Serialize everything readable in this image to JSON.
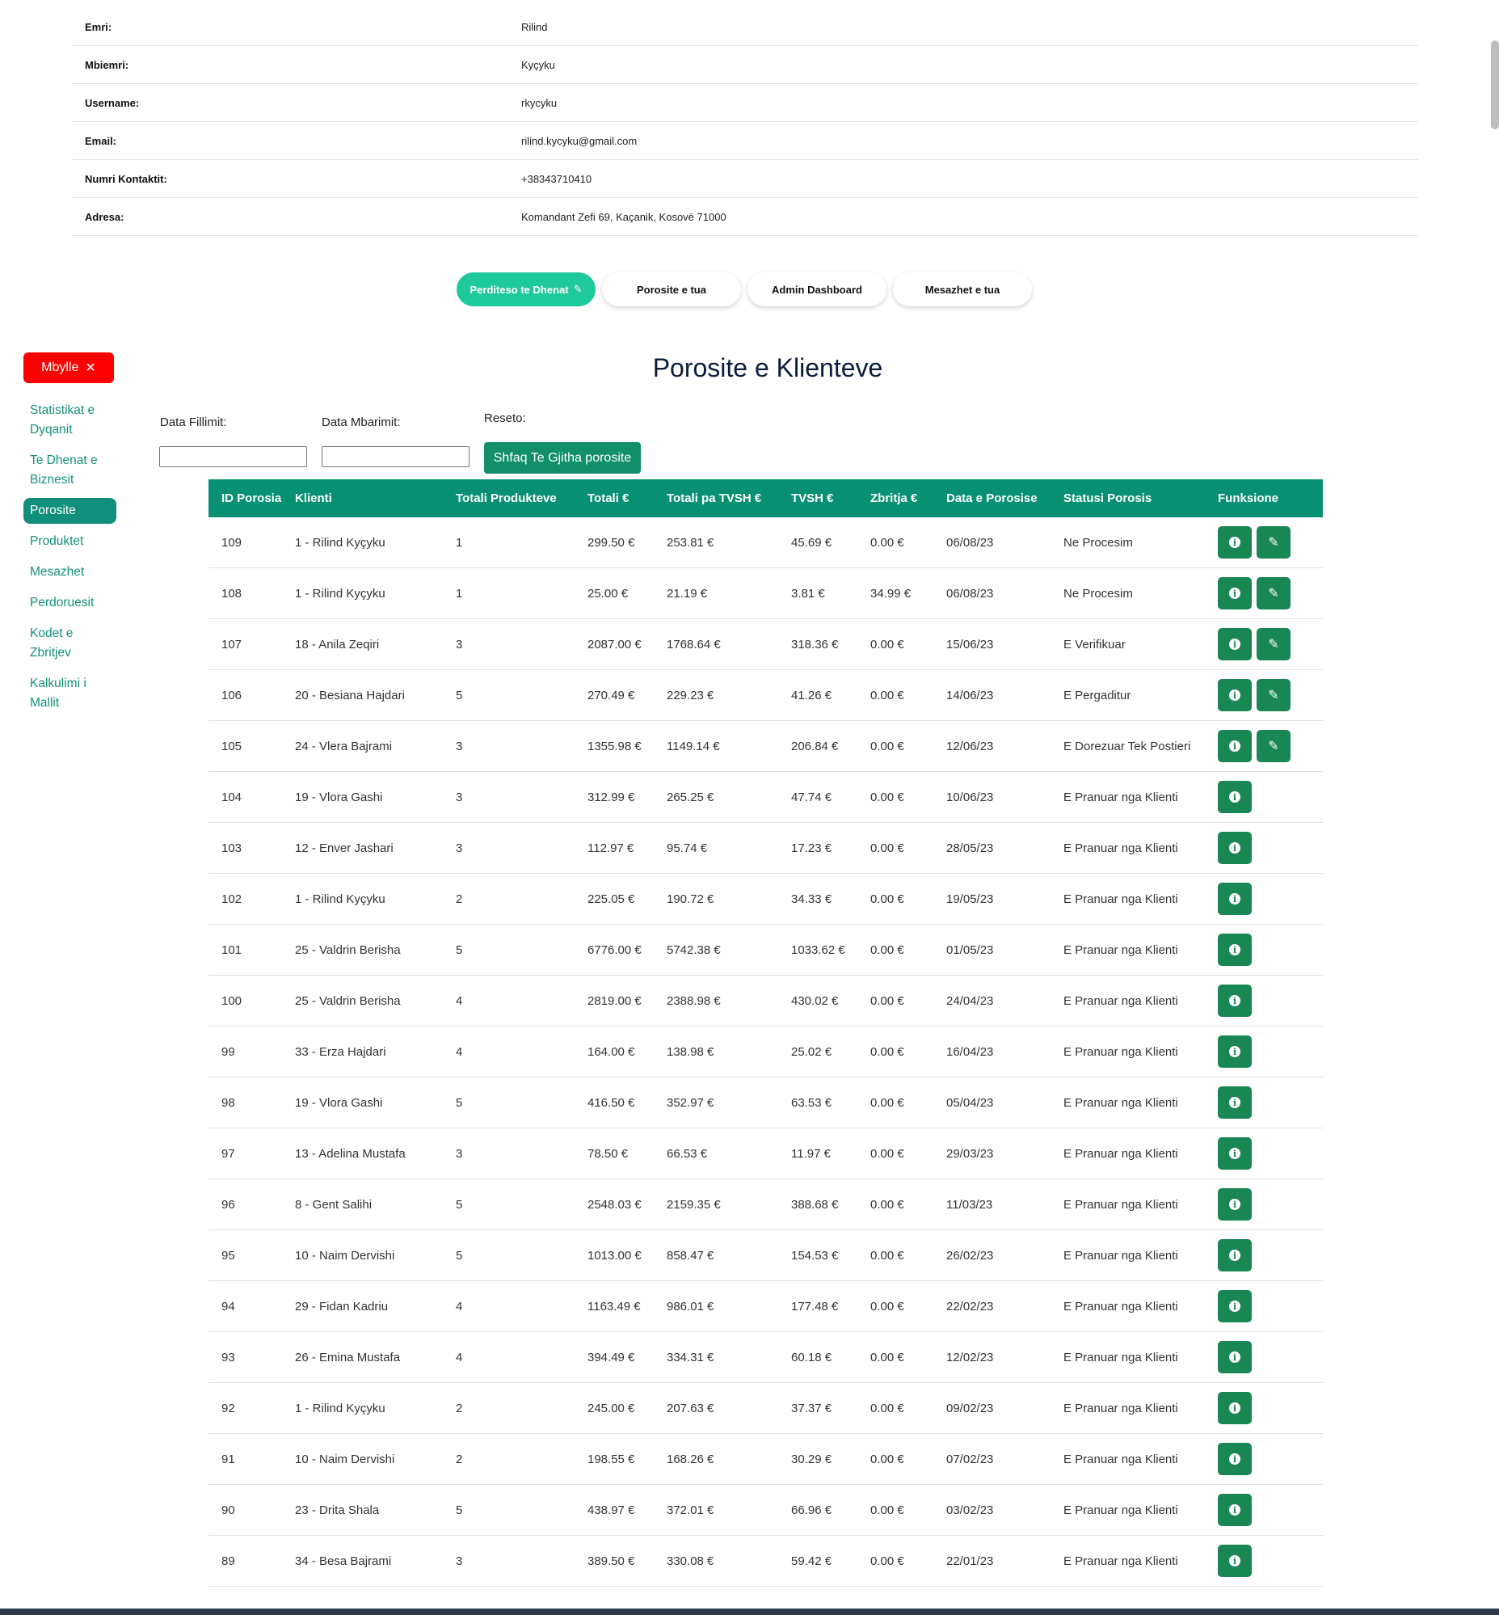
{
  "profile": [
    {
      "label": "Emri:",
      "value": "Rilind"
    },
    {
      "label": "Mbiemri:",
      "value": "Kyçyku"
    },
    {
      "label": "Username:",
      "value": "rkycyku"
    },
    {
      "label": "Email:",
      "value": "rilind.kycyku@gmail.com"
    },
    {
      "label": "Numri Kontaktit:",
      "value": "+38343710410"
    },
    {
      "label": "Adresa:",
      "value": "Komandant Zefi 69, Kaçanik, Kosovë 71000"
    }
  ],
  "actions": [
    {
      "label": "Perditeso te Dhenat",
      "icon": "edit-icon"
    },
    {
      "label": "Porosite e tua"
    },
    {
      "label": "Admin Dashboard"
    },
    {
      "label": "Mesazhet e tua"
    }
  ],
  "close_button": {
    "label": "Mbylle",
    "icon": "✕"
  },
  "sidebar": [
    {
      "label": "Statistikat e Dyqanit"
    },
    {
      "label": "Te Dhenat e Biznesit"
    },
    {
      "label": "Porosite"
    },
    {
      "label": "Produktet"
    },
    {
      "label": "Mesazhet"
    },
    {
      "label": "Perdoruesit"
    },
    {
      "label": "Kodet e Zbritjev"
    },
    {
      "label": "Kalkulimi i Mallit"
    }
  ],
  "title": "Porosite e Klienteve",
  "filters": {
    "start_label": "Data Fillimit:",
    "end_label": "Data Mbarimit:",
    "reset_label": "Reseto:",
    "show_all": "Shfaq Te Gjitha porosite"
  },
  "table": {
    "headers": [
      "ID Porosia",
      "Klienti",
      "Totali Produkteve",
      "Totali €",
      "Totali pa TVSH €",
      "TVSH €",
      "Zbritja €",
      "Data e Porosise",
      "Statusi Porosis",
      "Funksione"
    ],
    "rows": [
      [
        "109",
        "1 - Rilind Kyçyku",
        "1",
        "299.50 €",
        "253.81 €",
        "45.69 €",
        "0.00 €",
        "06/08/23",
        "Ne Procesim"
      ],
      [
        "108",
        "1 - Rilind Kyçyku",
        "1",
        "25.00 €",
        "21.19 €",
        "3.81 €",
        "34.99 €",
        "06/08/23",
        "Ne Procesim"
      ],
      [
        "107",
        "18 - Anila Zeqiri",
        "3",
        "2087.00 €",
        "1768.64 €",
        "318.36 €",
        "0.00 €",
        "15/06/23",
        "E Verifikuar"
      ],
      [
        "106",
        "20 - Besiana Hajdari",
        "5",
        "270.49 €",
        "229.23 €",
        "41.26 €",
        "0.00 €",
        "14/06/23",
        "E Pergaditur"
      ],
      [
        "105",
        "24 - Vlera Bajrami",
        "3",
        "1355.98 €",
        "1149.14 €",
        "206.84 €",
        "0.00 €",
        "12/06/23",
        "E Dorezuar Tek Postieri"
      ],
      [
        "104",
        "19 - Vlora Gashi",
        "3",
        "312.99 €",
        "265.25 €",
        "47.74 €",
        "0.00 €",
        "10/06/23",
        "E Pranuar nga Klienti"
      ],
      [
        "103",
        "12 - Enver Jashari",
        "3",
        "112.97 €",
        "95.74 €",
        "17.23 €",
        "0.00 €",
        "28/05/23",
        "E Pranuar nga Klienti"
      ],
      [
        "102",
        "1 - Rilind Kyçyku",
        "2",
        "225.05 €",
        "190.72 €",
        "34.33 €",
        "0.00 €",
        "19/05/23",
        "E Pranuar nga Klienti"
      ],
      [
        "101",
        "25 - Valdrin Berisha",
        "5",
        "6776.00 €",
        "5742.38 €",
        "1033.62 €",
        "0.00 €",
        "01/05/23",
        "E Pranuar nga Klienti"
      ],
      [
        "100",
        "25 - Valdrin Berisha",
        "4",
        "2819.00 €",
        "2388.98 €",
        "430.02 €",
        "0.00 €",
        "24/04/23",
        "E Pranuar nga Klienti"
      ],
      [
        "99",
        "33 - Erza Hajdari",
        "4",
        "164.00 €",
        "138.98 €",
        "25.02 €",
        "0.00 €",
        "16/04/23",
        "E Pranuar nga Klienti"
      ],
      [
        "98",
        "19 - Vlora Gashi",
        "5",
        "416.50 €",
        "352.97 €",
        "63.53 €",
        "0.00 €",
        "05/04/23",
        "E Pranuar nga Klienti"
      ],
      [
        "97",
        "13 - Adelina Mustafa",
        "3",
        "78.50 €",
        "66.53 €",
        "11.97 €",
        "0.00 €",
        "29/03/23",
        "E Pranuar nga Klienti"
      ],
      [
        "96",
        "8 - Gent Salihi",
        "5",
        "2548.03 €",
        "2159.35 €",
        "388.68 €",
        "0.00 €",
        "11/03/23",
        "E Pranuar nga Klienti"
      ],
      [
        "95",
        "10 - Naim Dervishi",
        "5",
        "1013.00 €",
        "858.47 €",
        "154.53 €",
        "0.00 €",
        "26/02/23",
        "E Pranuar nga Klienti"
      ],
      [
        "94",
        "29 - Fidan Kadriu",
        "4",
        "1163.49 €",
        "986.01 €",
        "177.48 €",
        "0.00 €",
        "22/02/23",
        "E Pranuar nga Klienti"
      ],
      [
        "93",
        "26 - Emina Mustafa",
        "4",
        "394.49 €",
        "334.31 €",
        "60.18 €",
        "0.00 €",
        "12/02/23",
        "E Pranuar nga Klienti"
      ],
      [
        "92",
        "1 - Rilind Kyçyku",
        "2",
        "245.00 €",
        "207.63 €",
        "37.37 €",
        "0.00 €",
        "09/02/23",
        "E Pranuar nga Klienti"
      ],
      [
        "91",
        "10 - Naim Dervishi",
        "2",
        "198.55 €",
        "168.26 €",
        "30.29 €",
        "0.00 €",
        "07/02/23",
        "E Pranuar nga Klienti"
      ],
      [
        "90",
        "23 - Drita Shala",
        "5",
        "438.97 €",
        "372.01 €",
        "66.96 €",
        "0.00 €",
        "03/02/23",
        "E Pranuar nga Klienti"
      ],
      [
        "89",
        "34 - Besa Bajrami",
        "3",
        "389.50 €",
        "330.08 €",
        "59.42 €",
        "0.00 €",
        "22/01/23",
        "E Pranuar nga Klienti"
      ]
    ],
    "editable_rows": 5
  },
  "icons": {
    "info": "info-icon",
    "edit": "edit-icon"
  },
  "colors": {
    "primary": "#079071",
    "active_pill": "#1ec99b",
    "close": "#ff0000",
    "button": "#198754"
  }
}
